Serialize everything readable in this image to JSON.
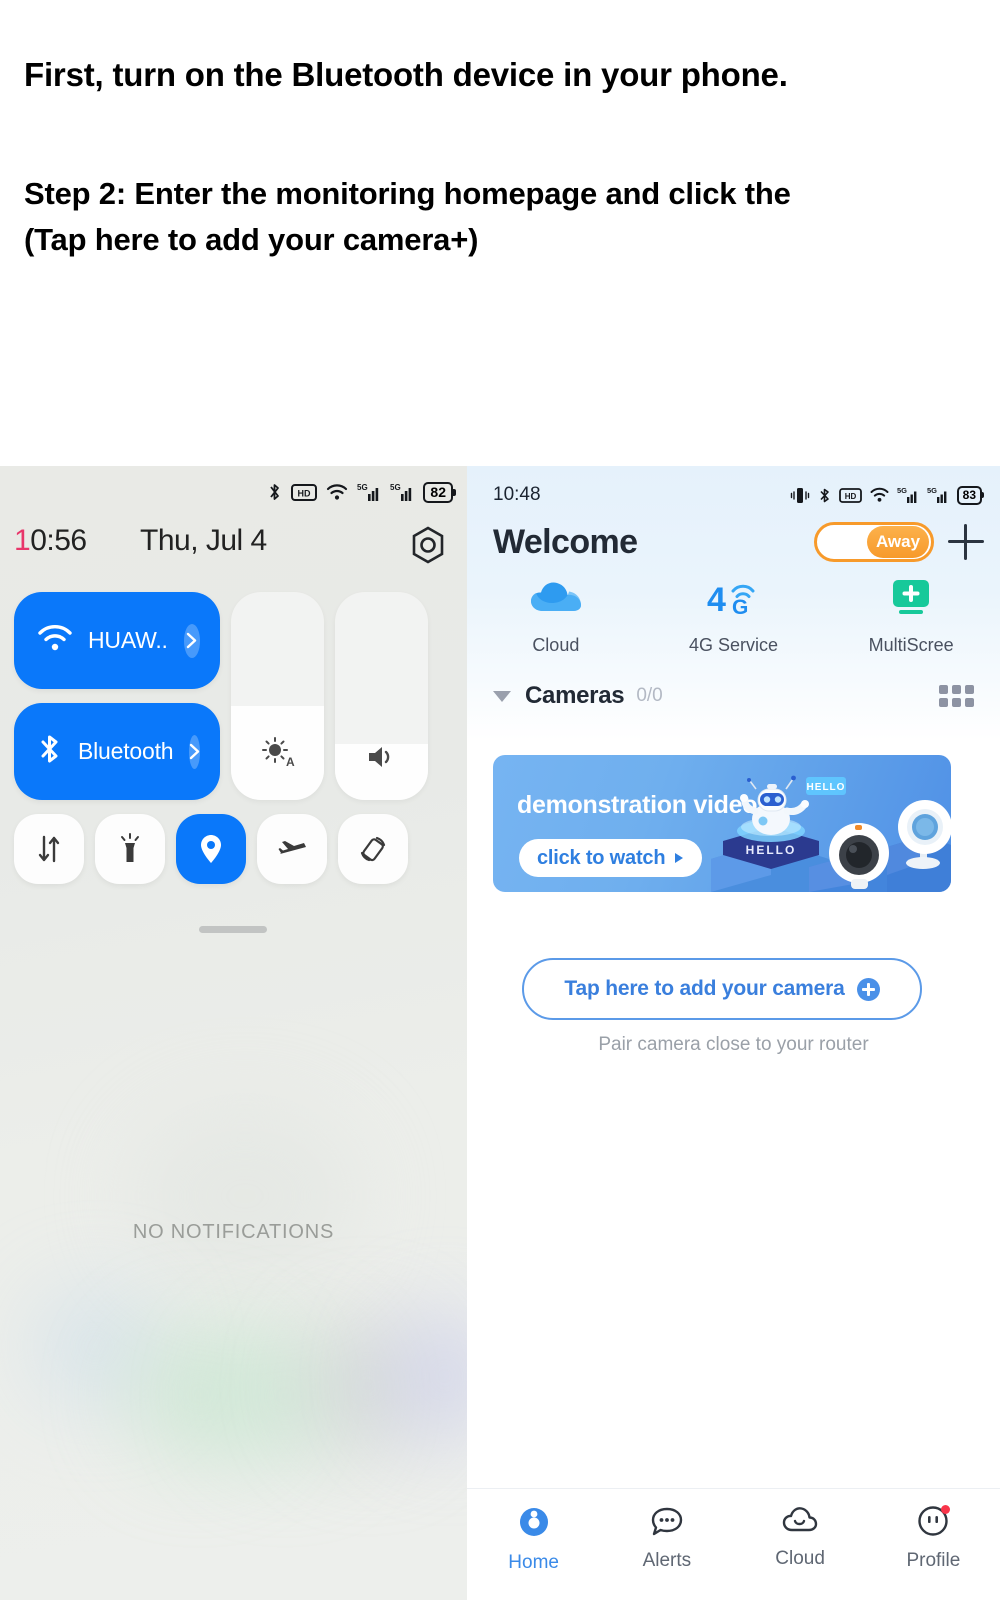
{
  "instructions": {
    "line1": "First, turn on the Bluetooth device in your phone.",
    "line2": "Step 2: Enter the monitoring homepage and click the",
    "line3": "(Tap here to add your camera+)"
  },
  "left_phone": {
    "status_bar": {
      "bluetooth_icon": "bluetooth-icon",
      "hd_icon": "hd-icon",
      "wifi_icon": "wifi-icon",
      "signal1_icon": "5g-signal-icon",
      "signal2_icon": "5g-signal-icon",
      "battery": "82"
    },
    "time": "10:56",
    "time_highlight": "1",
    "time_rest": "0:56",
    "date": "Thu, Jul 4",
    "settings_icon": "settings-hex-icon",
    "toggles": {
      "wifi": {
        "label": "HUAW..",
        "icon": "wifi-icon",
        "active": true,
        "chevron": "›"
      },
      "bluetooth": {
        "label": "Bluetooth",
        "icon": "bluetooth-icon",
        "active": true,
        "chevron": "›"
      },
      "brightness": {
        "icon": "brightness-auto-icon",
        "fill_percent": 45
      },
      "volume": {
        "icon": "volume-icon",
        "fill_percent": 27
      }
    },
    "quick_toggles": [
      {
        "name": "mobile-data",
        "icon": "data-transfer-icon",
        "active": false
      },
      {
        "name": "flashlight",
        "icon": "flashlight-icon",
        "active": false
      },
      {
        "name": "location",
        "icon": "location-pin-icon",
        "active": true
      },
      {
        "name": "airplane-mode",
        "icon": "airplane-icon",
        "active": false
      },
      {
        "name": "auto-rotate",
        "icon": "rotate-icon",
        "active": false
      }
    ],
    "no_notifications": "NO NOTIFICATIONS",
    "accent_color": "#0a78fa"
  },
  "right_phone": {
    "status_bar": {
      "vibrate_icon": "vibrate-icon",
      "bluetooth_icon": "bluetooth-icon",
      "hd_icon": "hd-icon",
      "wifi_icon": "wifi-icon",
      "signal1_icon": "5g-signal-icon",
      "signal2_icon": "5g-signal-icon",
      "battery": "83"
    },
    "time": "10:48",
    "title": "Welcome",
    "away_toggle": {
      "label": "Away",
      "state": "on",
      "color": "#f79a2b"
    },
    "add_icon": "plus-icon",
    "services": [
      {
        "label": "Cloud",
        "icon": "cloud-icon",
        "color": "#2e9bf0"
      },
      {
        "label": "4G Service",
        "icon": "4g-service-icon",
        "color": "#1f8df0",
        "text": "4",
        "sub": "G"
      },
      {
        "label": "MultiScree",
        "icon": "multiscreen-plus-icon",
        "color": "#17c99a"
      }
    ],
    "cameras_section": {
      "collapse_icon": "triangle-down-icon",
      "title": "Cameras",
      "count": "0/0",
      "grid_icon": "grid-view-icon"
    },
    "banner": {
      "title": "demonstration video",
      "button_label": "click to watch",
      "button_arrow": "▸",
      "robot_sign": "HELLO",
      "pedestal_text": "HELLO",
      "accent": "#5e9fe9"
    },
    "add_camera": {
      "label": "Tap here to add your camera",
      "plus_icon": "plus-circle-icon",
      "hint": "Pair camera close to your router",
      "border_color": "#5b9ae8"
    },
    "bottom_nav": [
      {
        "label": "Home",
        "icon": "home-lens-icon",
        "active": true,
        "badge": false
      },
      {
        "label": "Alerts",
        "icon": "chat-bubble-icon",
        "active": false,
        "badge": false
      },
      {
        "label": "Cloud",
        "icon": "cloud-outline-icon",
        "active": false,
        "badge": false
      },
      {
        "label": "Profile",
        "icon": "profile-face-icon",
        "active": false,
        "badge": true
      }
    ],
    "accent_color": "#3a8ae8"
  }
}
